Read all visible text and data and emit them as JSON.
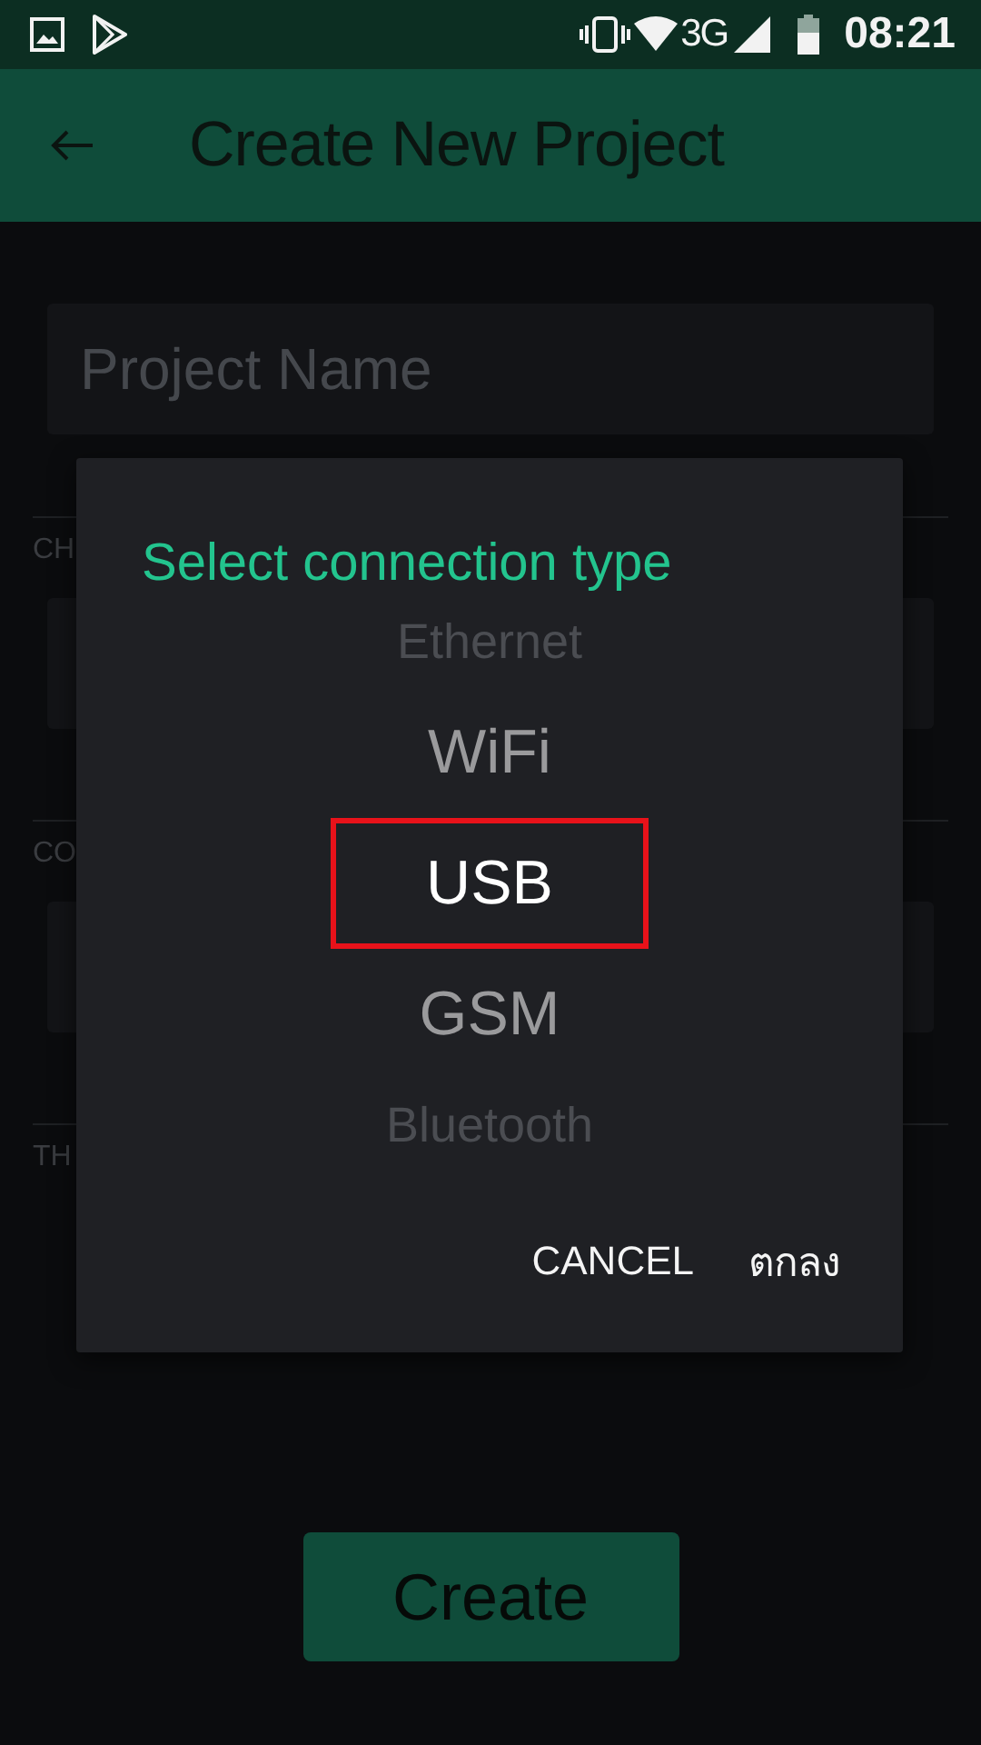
{
  "status_bar": {
    "network": "3G",
    "time": "08:21"
  },
  "app_bar": {
    "title": "Create New Project"
  },
  "form": {
    "project_name": {
      "placeholder": "Project Name"
    },
    "sections": [
      {
        "label": "CH",
        "has_field": true
      },
      {
        "label": "CO",
        "has_field": true
      },
      {
        "label": "TH",
        "has_field": false
      }
    ],
    "create_button": "Create"
  },
  "dialog": {
    "title": "Select connection type",
    "options": [
      {
        "label": "Ethernet",
        "selected": false,
        "edge": true
      },
      {
        "label": "WiFi",
        "selected": false,
        "edge": false
      },
      {
        "label": "USB",
        "selected": true,
        "edge": false
      },
      {
        "label": "GSM",
        "selected": false,
        "edge": false
      },
      {
        "label": "Bluetooth",
        "selected": false,
        "edge": true
      }
    ],
    "buttons": [
      "CANCEL",
      "ตกลง"
    ]
  }
}
